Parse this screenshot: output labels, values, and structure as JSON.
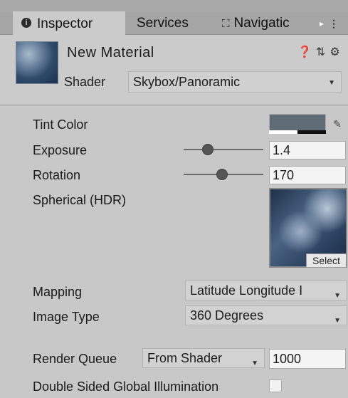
{
  "tabs": {
    "inspector": "Inspector",
    "services": "Services",
    "navigation": "Navigatic",
    "info_icon_glyph": "i",
    "nav_icon_glyph": "⛶",
    "more_glyph": "▸",
    "menu_glyph": "⋮"
  },
  "header": {
    "material_name": "New Material",
    "shader_label": "Shader",
    "shader_value": "Skybox/Panoramic",
    "help_glyph": "❓",
    "preset_glyph": "⇅",
    "settings_glyph": "⚙"
  },
  "properties": {
    "tint_color": {
      "label": "Tint Color",
      "color": "#5f6b75"
    },
    "exposure": {
      "label": "Exposure",
      "value": "1.4",
      "slider_fraction": 0.27
    },
    "rotation": {
      "label": "Rotation",
      "value": "170",
      "slider_fraction": 0.47
    },
    "spherical": {
      "label": "Spherical  (HDR)",
      "select_label": "Select"
    },
    "mapping": {
      "label": "Mapping",
      "value": "Latitude Longitude I"
    },
    "image_type": {
      "label": "Image Type",
      "value": "360 Degrees"
    },
    "render_queue": {
      "label": "Render Queue",
      "mode": "From Shader",
      "value": "1000"
    },
    "double_sided_gi": {
      "label": "Double Sided Global Illumination",
      "checked": false
    }
  },
  "icons": {
    "dropdown_caret": "▼",
    "eyedropper": "✎"
  }
}
